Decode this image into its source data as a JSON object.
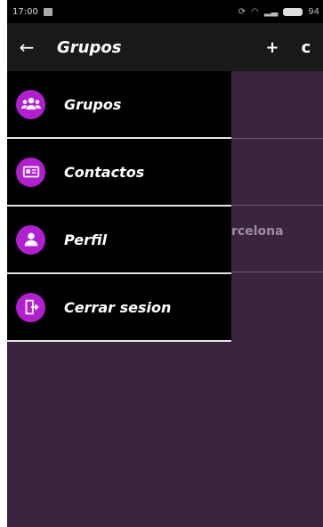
{
  "status_bar": {
    "time": "17:00",
    "battery": "94"
  },
  "app_bar": {
    "title": "Grupos",
    "back_icon": "←",
    "add_icon": "+",
    "refresh_icon": "c"
  },
  "background_list": {
    "partial_text": "rcelona"
  },
  "drawer": {
    "items": [
      {
        "label": "Grupos",
        "icon": "group-icon"
      },
      {
        "label": "Contactos",
        "icon": "contact-card-icon"
      },
      {
        "label": "Perfil",
        "icon": "person-icon"
      },
      {
        "label": "Cerrar sesion",
        "icon": "exit-door-icon"
      }
    ]
  },
  "colors": {
    "accent": "#b21fd1",
    "background": "#3a2440",
    "appbar": "#191919",
    "drawer": "#000000"
  }
}
